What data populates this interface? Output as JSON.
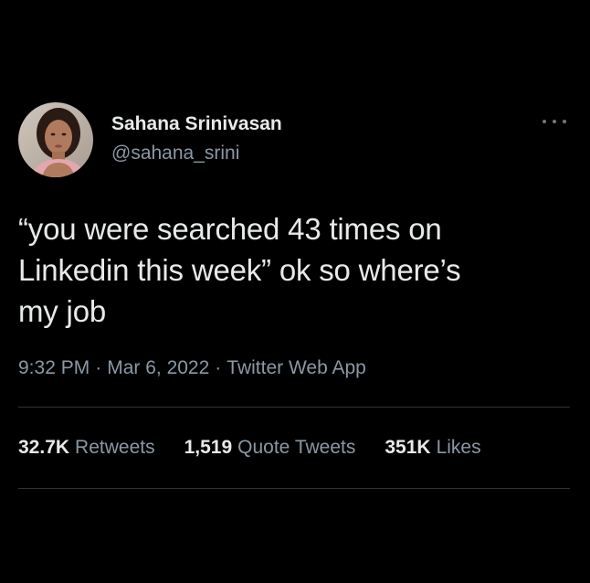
{
  "user": {
    "display_name": "Sahana Srinivasan",
    "handle": "@sahana_srini",
    "avatar_icon": "profile-photo"
  },
  "tweet": {
    "text_line1": "“you were searched 43 times on",
    "text_line2": "Linkedin this week” ok so where’s",
    "text_line3": "my job",
    "time": "9:32 PM",
    "date": "Mar 6, 2022",
    "source": "Twitter Web App",
    "separator": "·"
  },
  "stats": {
    "retweets_count": "32.7K",
    "retweets_label": "Retweets",
    "quote_count": "1,519",
    "quote_label": "Quote Tweets",
    "likes_count": "351K",
    "likes_label": "Likes"
  },
  "colors": {
    "background": "#000000",
    "primary_text": "#e7e9ea",
    "secondary_text": "#8b98a5",
    "divider": "#2f3336"
  }
}
